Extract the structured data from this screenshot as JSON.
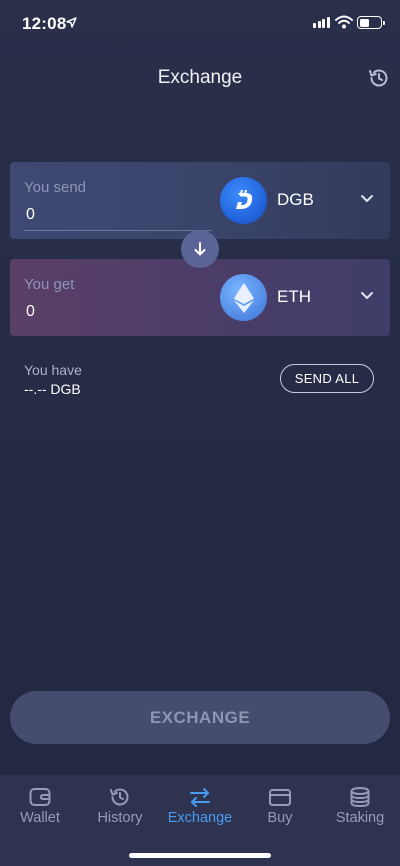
{
  "status_bar": {
    "time": "12:08"
  },
  "header": {
    "title": "Exchange"
  },
  "send_card": {
    "label": "You send",
    "value": "0",
    "coin": "DGB",
    "icon": "digibyte-icon"
  },
  "get_card": {
    "label": "You get",
    "value": "0",
    "coin": "ETH",
    "icon": "ethereum-icon"
  },
  "balance": {
    "label": "You have",
    "value": "--.-- DGB",
    "send_all_label": "SEND ALL"
  },
  "exchange_button": {
    "label": "EXCHANGE"
  },
  "nav": {
    "items": [
      {
        "label": "Wallet",
        "icon": "wallet-icon"
      },
      {
        "label": "History",
        "icon": "history-icon"
      },
      {
        "label": "Exchange",
        "icon": "exchange-icon",
        "active": true
      },
      {
        "label": "Buy",
        "icon": "card-icon"
      },
      {
        "label": "Staking",
        "icon": "coins-stack-icon"
      }
    ]
  },
  "colors": {
    "accent": "#4a9cf0",
    "background": "#262b45"
  }
}
